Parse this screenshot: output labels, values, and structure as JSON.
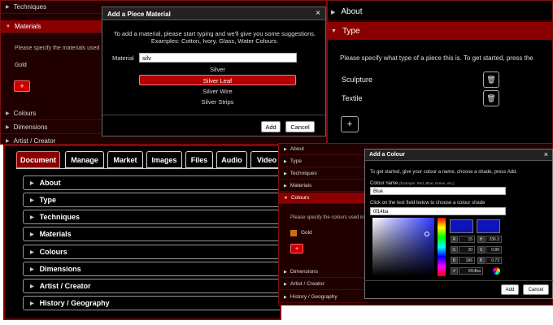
{
  "panel1": {
    "sections": {
      "techniques": "Techniques",
      "materials": "Materials",
      "colours": "Colours",
      "dimensions": "Dimensions",
      "artist": "Artist / Creator"
    },
    "prompt": "Please specify the materials used",
    "value": "Gold",
    "add_label": "+"
  },
  "material_dialog": {
    "title": "Add a Piece Material",
    "close": "×",
    "message_line1": "To add a material, please start typing and we'll give you some suggestions.",
    "message_line2": "Examples: Cotton, Ivory, Glass, Water Colours.",
    "field_label": "Material",
    "input_value": "silv",
    "suggestions": [
      "Silver",
      "Silver Leaf",
      "Silver Wire",
      "Silver Strips"
    ],
    "add_button": "Add",
    "cancel_button": "Cancel"
  },
  "panel2": {
    "about": "About",
    "type": "Type",
    "prompt": "Please specify what type of a piece this is. To get started, press the",
    "items": [
      "Sculpture",
      "Textile"
    ],
    "add_label": "+"
  },
  "panel3": {
    "tabs": [
      "Document",
      "Manage",
      "Market",
      "Images",
      "Files",
      "Audio",
      "Video"
    ],
    "sections": [
      "About",
      "Type",
      "Techniques",
      "Materials",
      "Colours",
      "Dimensions",
      "Artist / Creator",
      "History / Geography"
    ]
  },
  "panel4": {
    "sections": [
      "About",
      "Type",
      "Techniques",
      "Materials",
      "Colours",
      "Dimensions",
      "Artist / Creator",
      "History / Geography"
    ],
    "prompt": "Please specify the colours used in",
    "value": "Gold",
    "add_label": "+"
  },
  "colour_dialog": {
    "title": "Add a Colour",
    "close": "×",
    "instructions": "To get started, give your colour a name, choose a shade, press Add.",
    "name_label": "Colour name",
    "name_hint": "(Example: Red, Blue, Green, etc.)",
    "name_value": "Blue",
    "shade_label": "Click on the text field below to choose a colour shade",
    "shade_value": "0f14ba",
    "fields": {
      "R": "15",
      "G": "20",
      "B": "186",
      "H": "236.3",
      "S": "0.89",
      "Bv": "0.73",
      "hash": "0f14ba"
    },
    "add_button": "Add",
    "cancel_button": "Cancel",
    "colors": {
      "selected": "#0f14ba",
      "accent": "#8a0000"
    }
  }
}
